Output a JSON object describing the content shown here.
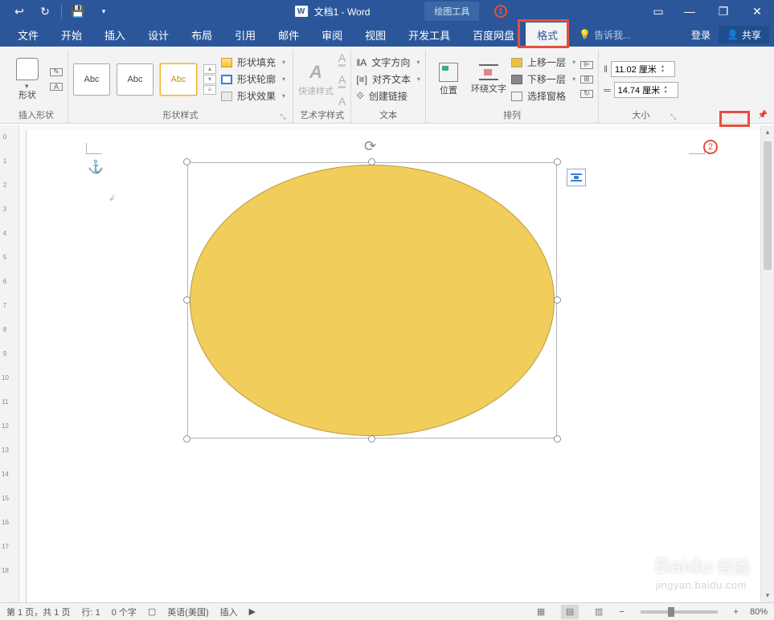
{
  "titlebar": {
    "doc_title": "文档1 - Word",
    "tool_tab": "绘图工具"
  },
  "tabs": {
    "file": "文件",
    "home": "开始",
    "insert": "插入",
    "design": "设计",
    "layout": "布局",
    "references": "引用",
    "mailings": "邮件",
    "review": "审阅",
    "view": "视图",
    "developer": "开发工具",
    "baidu": "百度网盘",
    "format": "格式",
    "tell_me": "告诉我...",
    "login": "登录",
    "share": "共享"
  },
  "ribbon": {
    "insert_shapes": {
      "label": "插入形状",
      "shapes_btn": "形状"
    },
    "shape_styles": {
      "label": "形状样式",
      "abc": "Abc",
      "fill": "形状填充",
      "outline": "形状轮廓",
      "effects": "形状效果"
    },
    "wordart": {
      "label": "艺术字样式",
      "quick": "快速样式"
    },
    "text": {
      "label": "文本",
      "direction": "文字方向",
      "align": "对齐文本",
      "link": "创建链接"
    },
    "arrange": {
      "label": "排列",
      "position": "位置",
      "wrap": "环绕文字",
      "forward": "上移一层",
      "backward": "下移一层",
      "selection": "选择窗格"
    },
    "size": {
      "label": "大小",
      "height": "11.02 厘米",
      "width": "14.74 厘米"
    }
  },
  "status": {
    "page": "第 1 页，共 1 页",
    "line": "行: 1",
    "words": "0 个字",
    "lang": "英语(美国)",
    "insert": "插入",
    "zoom": "80%"
  },
  "watermark": {
    "brand": "Baidu",
    "sub": "经验",
    "url": "jingyan.baidu.com"
  },
  "callouts": {
    "c1": "1",
    "c2": "2"
  }
}
